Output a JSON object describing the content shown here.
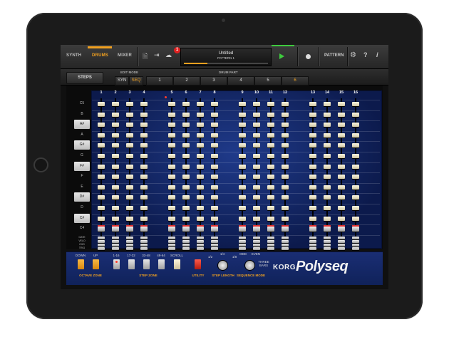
{
  "toolbar": {
    "tabs": [
      {
        "label": "SYNTH",
        "active": false
      },
      {
        "label": "DRUMS",
        "active": true
      },
      {
        "label": "MIXER",
        "active": false
      }
    ],
    "notification_count": "1",
    "song_title": "Untitled",
    "pattern_name": "PATTERN 1",
    "pattern_button": "PATTERN",
    "help": "?",
    "info": "i",
    "progress": 0.28,
    "accent_color": "#f0a020",
    "play_color": "#3ecb3e"
  },
  "subbar": {
    "steps_label": "STEPS",
    "edit_mode_label": "EDIT MODE",
    "edit_modes": [
      {
        "label": "SYN",
        "active": false
      },
      {
        "label": "SEQ",
        "active": true
      }
    ],
    "drum_part_label": "DRUM PART",
    "drum_parts": [
      {
        "label": "1",
        "active": false
      },
      {
        "label": "2",
        "active": false
      },
      {
        "label": "3",
        "active": false
      },
      {
        "label": "4",
        "active": false
      },
      {
        "label": "5",
        "active": false
      },
      {
        "label": "6",
        "active": true
      }
    ]
  },
  "grid": {
    "step_numbers": [
      "1",
      "2",
      "3",
      "4",
      "5",
      "6",
      "7",
      "8",
      "9",
      "10",
      "11",
      "12",
      "13",
      "14",
      "15",
      "16"
    ],
    "keys": [
      {
        "label": "C5",
        "type": "white"
      },
      {
        "label": "B",
        "type": "white"
      },
      {
        "label": "A#",
        "type": "black"
      },
      {
        "label": "A",
        "type": "white"
      },
      {
        "label": "G#",
        "type": "black"
      },
      {
        "label": "G",
        "type": "white"
      },
      {
        "label": "F#",
        "type": "black"
      },
      {
        "label": "F",
        "type": "white"
      },
      {
        "label": "E",
        "type": "white"
      },
      {
        "label": "D#",
        "type": "black"
      },
      {
        "label": "D",
        "type": "white"
      },
      {
        "label": "C#",
        "type": "black"
      },
      {
        "label": "C4",
        "type": "white"
      }
    ],
    "row_labels": [
      "GATE",
      "VELO",
      "CHG",
      "TRIG"
    ],
    "selected_notes": [
      "C4",
      "C4",
      "C4",
      "C4",
      "C4",
      "C4",
      "C4",
      "C4",
      "C4",
      "C4",
      "C4",
      "C4",
      "C4",
      "C4",
      "C4",
      "C4"
    ]
  },
  "bottom": {
    "octave": {
      "down": "DOWN",
      "up": "UP",
      "zone_label": "OCTAVE ZONE"
    },
    "step_zone": {
      "buttons": [
        "1-16",
        "17-32",
        "33-48",
        "49-64",
        "SCROLL"
      ],
      "zone_label": "STEP ZONE"
    },
    "utility_label": "UTILITY",
    "step_length_label": "STEP LENGTH",
    "step_length_values": [
      "1/2",
      "1/4",
      "1/8"
    ],
    "sequence_mode_label": "SEQUENCE MODE",
    "sequence_mode_values": [
      "ODD",
      "EVEN",
      "THREE BARS"
    ],
    "brand": "KORG",
    "product": "Polyseq"
  }
}
